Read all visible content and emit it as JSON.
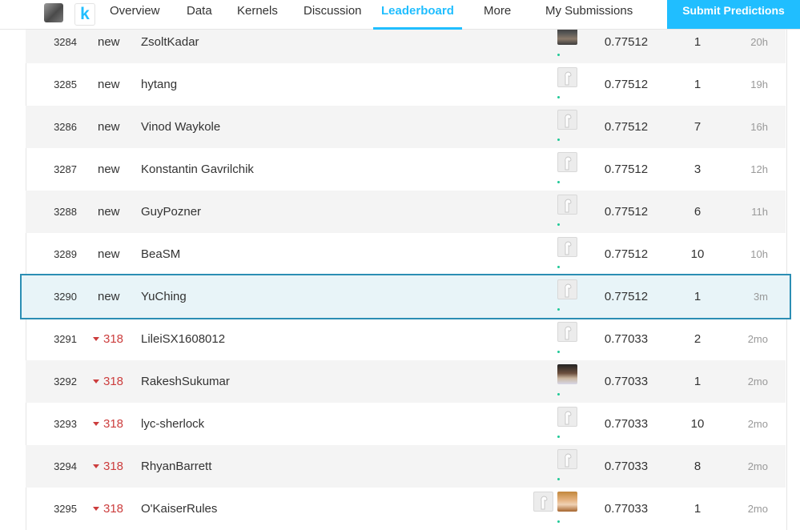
{
  "nav": {
    "items": [
      "Overview",
      "Data",
      "Kernels",
      "Discussion",
      "Leaderboard",
      "More"
    ],
    "my_submissions": "My Submissions",
    "submit": "Submit Predictions",
    "logo_letter": "k",
    "active_tab": "Leaderboard",
    "accent_color": "#20beff"
  },
  "leaderboard": {
    "rows": [
      {
        "rank": "3284",
        "change": "new",
        "team": "ZsoltKadar",
        "avatar": "photo",
        "score": "0.77512",
        "entries": "1",
        "last": "20h"
      },
      {
        "rank": "3285",
        "change": "new",
        "team": "hytang",
        "avatar": "default",
        "score": "0.77512",
        "entries": "1",
        "last": "19h"
      },
      {
        "rank": "3286",
        "change": "new",
        "team": "Vinod Waykole",
        "avatar": "default",
        "score": "0.77512",
        "entries": "7",
        "last": "16h"
      },
      {
        "rank": "3287",
        "change": "new",
        "team": "Konstantin Gavrilchik",
        "avatar": "default",
        "score": "0.77512",
        "entries": "3",
        "last": "12h"
      },
      {
        "rank": "3288",
        "change": "new",
        "team": "GuyPozner",
        "avatar": "default",
        "score": "0.77512",
        "entries": "6",
        "last": "11h"
      },
      {
        "rank": "3289",
        "change": "new",
        "team": "BeaSM",
        "avatar": "default",
        "score": "0.77512",
        "entries": "10",
        "last": "10h"
      },
      {
        "rank": "3290",
        "change": "new",
        "team": "YuChing",
        "avatar": "default",
        "score": "0.77512",
        "entries": "1",
        "last": "3m",
        "highlight": true
      },
      {
        "rank": "3291",
        "change": "318",
        "team": "LileiSX1608012",
        "avatar": "default",
        "score": "0.77033",
        "entries": "2",
        "last": "2mo"
      },
      {
        "rank": "3292",
        "change": "318",
        "team": "RakeshSukumar",
        "avatar": "photo",
        "score": "0.77033",
        "entries": "1",
        "last": "2mo"
      },
      {
        "rank": "3293",
        "change": "318",
        "team": "lyc-sherlock",
        "avatar": "default",
        "score": "0.77033",
        "entries": "10",
        "last": "2mo"
      },
      {
        "rank": "3294",
        "change": "318",
        "team": "RhyanBarrett",
        "avatar": "default",
        "score": "0.77033",
        "entries": "8",
        "last": "2mo"
      },
      {
        "rank": "3295",
        "change": "318",
        "team": "O'KaiserRules",
        "avatar": "photo",
        "score": "0.77033",
        "entries": "1",
        "last": "2mo",
        "extra_member": true
      }
    ],
    "colors": {
      "down": "#cc3d3d",
      "highlight_border": "#2b8eb4",
      "highlight_bg": "#e8f4f8"
    }
  }
}
